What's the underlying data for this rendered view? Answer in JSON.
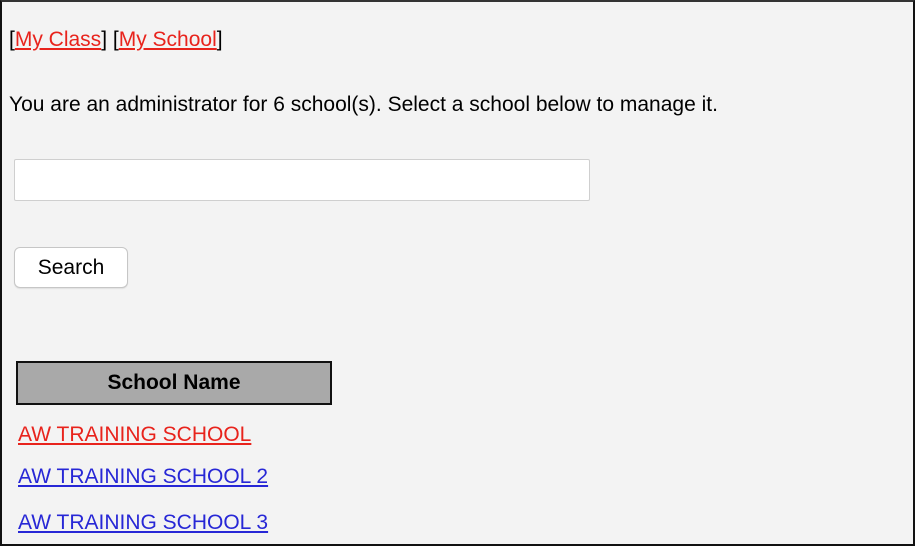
{
  "nav": {
    "open_bracket": "[",
    "my_class": "My Class",
    "mid_bracket": "] [",
    "my_school": "My School",
    "close_bracket": "]",
    "link_color": "#e8231c"
  },
  "intro_text": "You are an administrator for 6 school(s). Select a school below to manage it.",
  "search": {
    "value": "",
    "placeholder": "",
    "button_label": "Search"
  },
  "table": {
    "header": "School Name",
    "header_bg": "#a9a9a9",
    "rows": [
      {
        "name": "AW TRAINING SCHOOL",
        "state": "visited"
      },
      {
        "name": "AW TRAINING SCHOOL 2",
        "state": "unvisited"
      },
      {
        "name": "AW TRAINING SCHOOL 3",
        "state": "unvisited"
      }
    ]
  },
  "colors": {
    "visited_link": "#e8231c",
    "link": "#2727d6",
    "background": "#f3f3f3"
  }
}
